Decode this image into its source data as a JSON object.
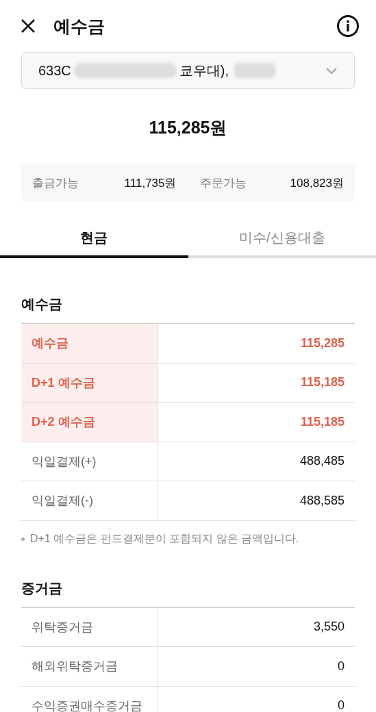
{
  "header": {
    "title": "예수금"
  },
  "account_select": {
    "prefix": "633C",
    "suffix": "쿄우대),"
  },
  "total": "115,285원",
  "summary": [
    {
      "label": "출금가능",
      "value": "111,735원"
    },
    {
      "label": "주문가능",
      "value": "108,823원"
    }
  ],
  "tabs": [
    {
      "label": "현금",
      "selected": true
    },
    {
      "label": "미수/신용대출",
      "selected": false
    }
  ],
  "sections": [
    {
      "title": "예수금",
      "rows": [
        {
          "label": "예수금",
          "value": "115,285",
          "highlighted": true
        },
        {
          "label": "D+1 예수금",
          "value": "115,185",
          "highlighted": true
        },
        {
          "label": "D+2 예수금",
          "value": "115,185",
          "highlighted": true
        },
        {
          "label": "익일결제(+)",
          "value": "488,485",
          "highlighted": false
        },
        {
          "label": "익일결제(-)",
          "value": "488,585",
          "highlighted": false
        }
      ],
      "note": "D+1 예수금은 펀드결제분이 포함되지 않은 금액입니다."
    },
    {
      "title": "증거금",
      "rows": [
        {
          "label": "위탁증거금",
          "value": "3,550",
          "highlighted": false
        },
        {
          "label": "해외위탁증거금",
          "value": "0",
          "highlighted": false
        },
        {
          "label": "수익증권매수증거금",
          "value": "0",
          "highlighted": false
        }
      ]
    }
  ]
}
